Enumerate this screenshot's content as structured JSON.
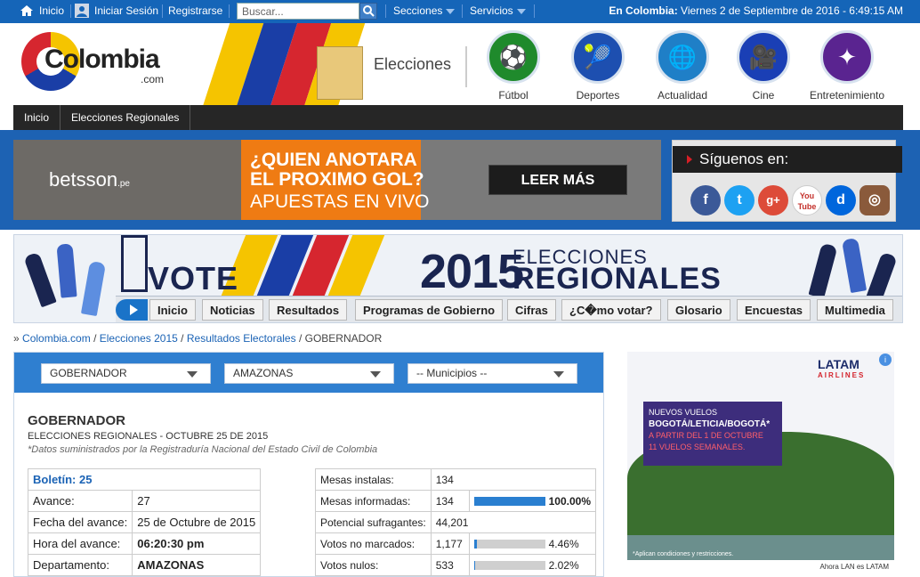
{
  "topbar": {
    "inicio": "Inicio",
    "login": "Iniciar Sesión",
    "register": "Registrarse",
    "search_placeholder": "Buscar...",
    "secciones": "Secciones",
    "servicios": "Servicios",
    "location_label": "En Colombia:",
    "datetime": "Viernes 2 de Septiembre de 2016 - 6:49:15 AM"
  },
  "header": {
    "logo_text": "Colombia",
    "logo_sub": ".com",
    "section_title": "Elecciones",
    "categories": [
      {
        "label": "Fútbol",
        "icon": "soccer-ball-icon",
        "color": "#1f8a2c"
      },
      {
        "label": "Deportes",
        "icon": "tennis-icon",
        "color": "#1d4fb0"
      },
      {
        "label": "Actualidad",
        "icon": "globe-icon",
        "color": "#1f7fc7"
      },
      {
        "label": "Cine",
        "icon": "camera-icon",
        "color": "#1a3fb5"
      },
      {
        "label": "Entretenimiento",
        "icon": "stars-icon",
        "color": "#5a2490"
      }
    ]
  },
  "nav": {
    "items": [
      "Inicio",
      "Elecciones Regionales"
    ]
  },
  "promo": {
    "brand": "betsson",
    "brand_suffix": ".pe",
    "headline": "¿QUIEN ANOTARA EL PROXIMO GOL?",
    "subline": "APUESTAS EN VIVO",
    "cta": "LEER MÁS"
  },
  "follow": {
    "title": "Síguenos en:",
    "networks": [
      {
        "icon": "facebook-icon",
        "glyph": "f",
        "color": "#3b5998"
      },
      {
        "icon": "twitter-icon",
        "glyph": "t",
        "color": "#1da1f2"
      },
      {
        "icon": "google-plus-icon",
        "glyph": "g+",
        "color": "#dd4b39"
      },
      {
        "icon": "youtube-icon",
        "glyph": "You Tube",
        "color": "#c4302b"
      },
      {
        "icon": "dailymotion-icon",
        "glyph": "d",
        "color": "#0066dc"
      },
      {
        "icon": "instagram-icon",
        "glyph": "◎",
        "color": "#8a5a3b"
      }
    ]
  },
  "elections_banner": {
    "vote": "VOTE",
    "year": "2015",
    "title_top": "ELECCIONES",
    "title_bottom": "REGIONALES",
    "menu": [
      "Inicio",
      "Noticias",
      "Resultados",
      "Programas de Gobierno",
      "Cifras",
      "¿C�mo votar?",
      "Glosario",
      "Encuestas",
      "Multimedia"
    ]
  },
  "breadcrumb": {
    "items": [
      "Colombia.com",
      "Elecciones 2015",
      "Resultados Electorales"
    ],
    "current": "GOBERNADOR",
    "prefix": "»",
    "separator": "/"
  },
  "filters": {
    "office": "GOBERNADOR",
    "department": "AMAZONAS",
    "municipality": "-- Municipios --"
  },
  "results": {
    "title": "GOBERNADOR",
    "subtitle": "ELECCIONES REGIONALES - OCTUBRE 25 DE 2015",
    "note": "*Datos suministrados por la Registraduría Nacional del Estado Civil de Colombia",
    "bulletin": {
      "label": "Boletín: 25",
      "rows": [
        {
          "label": "Avance:",
          "value": "27"
        },
        {
          "label": "Fecha del avance:",
          "value": "25 de Octubre de 2015"
        },
        {
          "label": "Hora del avance:",
          "value": "06:20:30 pm"
        },
        {
          "label": "Departamento:",
          "value": "AMAZONAS"
        }
      ]
    },
    "stats": [
      {
        "label": "Mesas instalas:",
        "value": "134",
        "pct": null,
        "fraction": null
      },
      {
        "label": "Mesas informadas:",
        "value": "134",
        "pct": "100.00%",
        "fraction": 1.0
      },
      {
        "label": "Potencial sufragantes:",
        "value": "44,201",
        "pct": null,
        "fraction": null
      },
      {
        "label": "Votos no marcados:",
        "value": "1,177",
        "pct": "4.46%",
        "fraction": 0.0446
      },
      {
        "label": "Votos nulos:",
        "value": "533",
        "pct": "2.02%",
        "fraction": 0.0202
      }
    ]
  },
  "ad": {
    "brand": "LATAM",
    "brand_sub": "AIRLINES",
    "line1": "NUEVOS VUELOS",
    "line2": "BOGOTÁ/LETICIA/BOGOTÁ*",
    "line3": "A PARTIR DEL 1 DE OCTUBRE",
    "line4": "11 VUELOS SEMANALES.",
    "fine_print": "*Aplican condiciones y restricciones.",
    "footer": "Ahora LAN es LATAM"
  }
}
